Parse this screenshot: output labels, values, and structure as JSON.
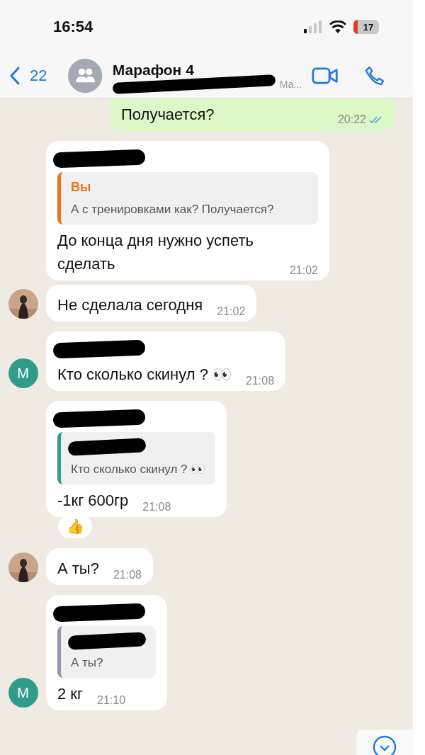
{
  "status_bar": {
    "time": "16:54",
    "battery": "17"
  },
  "header": {
    "back_count": "22",
    "title": "Марафон 4",
    "subtitle": "Ма...",
    "subtitle_redacted": true
  },
  "messages": [
    {
      "kind": "outgoing",
      "text": "Получается?",
      "time": "20:22",
      "read": true
    },
    {
      "kind": "incoming",
      "sender_redacted": true,
      "quote": {
        "author": "Вы",
        "text": "А с тренировками как? Получается?",
        "color": "#e8751a"
      },
      "text": "До конца дня нужно успеть сделать",
      "time": "21:02"
    },
    {
      "kind": "incoming",
      "text": "Не сделала сегодня",
      "time": "21:02"
    },
    {
      "kind": "incoming",
      "sender_redacted": true,
      "avatar": {
        "kind": "letter",
        "letter": "M",
        "color": "#2f9c8c"
      },
      "text": "Кто сколько скинул ? 👀",
      "time": "21:08"
    },
    {
      "kind": "incoming",
      "sender_redacted": true,
      "quote": {
        "author_redacted": true,
        "text": "Кто сколько скинул ? 👀",
        "color": "#2f9c8c"
      },
      "text": "-1кг 600гр",
      "time": "21:08",
      "reaction": "👍"
    },
    {
      "kind": "incoming",
      "text": "А ты?",
      "time": "21:08"
    },
    {
      "kind": "incoming",
      "sender_redacted": true,
      "quote": {
        "author_redacted": true,
        "text": "А ты?",
        "color": "#9a8fb0"
      },
      "avatar": {
        "kind": "letter",
        "letter": "M",
        "color": "#2f9c8c"
      },
      "text": "2 кг",
      "time": "21:10"
    }
  ]
}
